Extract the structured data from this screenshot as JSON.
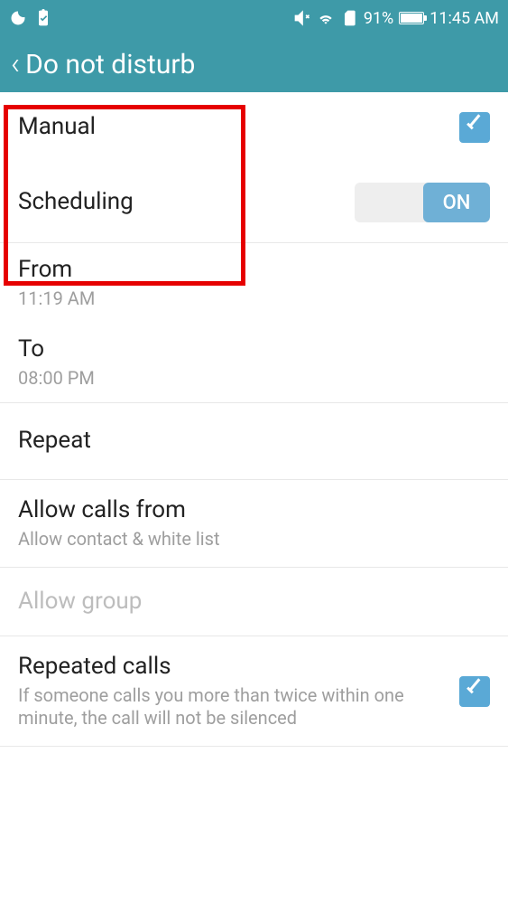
{
  "status": {
    "battery_pct": "91%",
    "time": "11:45 AM"
  },
  "header": {
    "title": "Do not disturb"
  },
  "rows": {
    "manual": {
      "label": "Manual"
    },
    "scheduling": {
      "label": "Scheduling",
      "toggle": "ON"
    },
    "from": {
      "label": "From",
      "value": "11:19 AM"
    },
    "to": {
      "label": "To",
      "value": "08:00 PM"
    },
    "repeat": {
      "label": "Repeat"
    },
    "allow_calls": {
      "label": "Allow calls from",
      "value": "Allow contact & white list"
    },
    "allow_group": {
      "label": "Allow group"
    },
    "repeated_calls": {
      "label": "Repeated calls",
      "value": "If someone calls you more than twice within one minute, the call will not be silenced"
    }
  }
}
